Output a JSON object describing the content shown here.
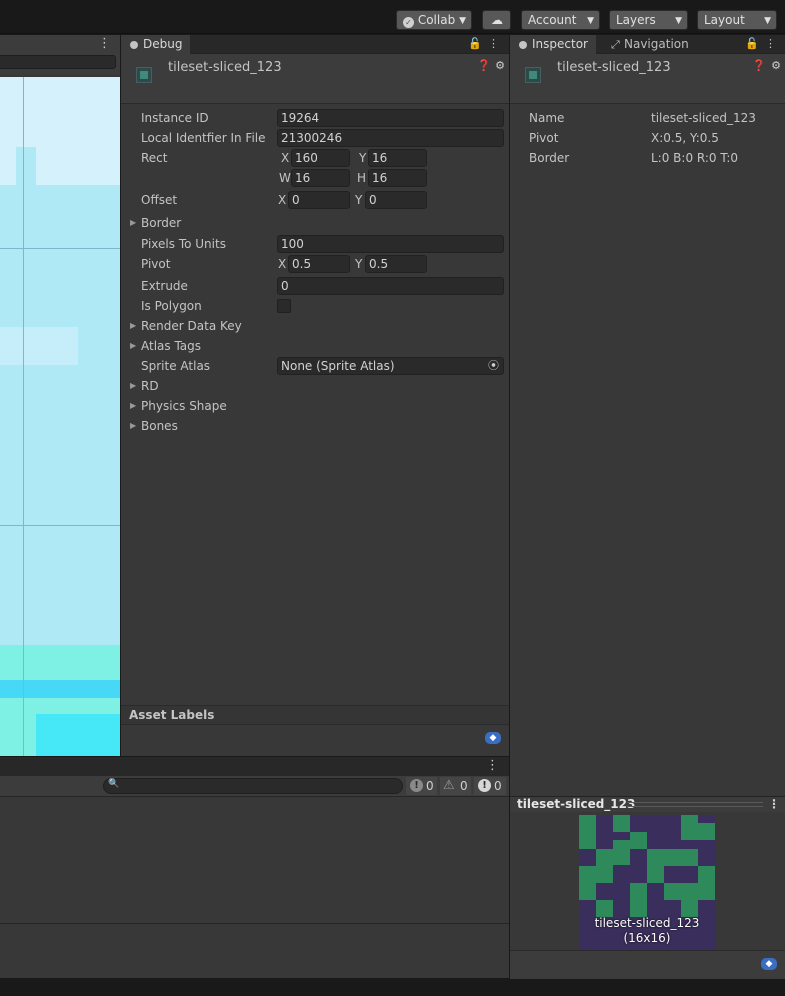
{
  "toolbar": {
    "collab": "Collab",
    "account": "Account",
    "layers": "Layers",
    "layout": "Layout"
  },
  "debug": {
    "tab_label": "Debug",
    "asset_name": "tileset-sliced_123",
    "fields": {
      "instance_id_label": "Instance ID",
      "instance_id": "19264",
      "local_id_label": "Local Identfier In File",
      "local_id": "21300246",
      "rect_label": "Rect",
      "rect_x": "160",
      "rect_y": "16",
      "rect_w": "16",
      "rect_h": "16",
      "offset_label": "Offset",
      "offset_x": "0",
      "offset_y": "0",
      "border_label": "Border",
      "ppu_label": "Pixels To Units",
      "ppu": "100",
      "pivot_label": "Pivot",
      "pivot_x": "0.5",
      "pivot_y": "0.5",
      "extrude_label": "Extrude",
      "extrude": "0",
      "is_polygon_label": "Is Polygon",
      "render_data_key_label": "Render Data Key",
      "atlas_tags_label": "Atlas Tags",
      "sprite_atlas_label": "Sprite Atlas",
      "sprite_atlas": "None (Sprite Atlas)",
      "rd_label": "RD",
      "physics_shape_label": "Physics Shape",
      "bones_label": "Bones"
    },
    "axis": {
      "x": "X",
      "y": "Y",
      "w": "W",
      "h": "H"
    },
    "asset_labels": "Asset Labels"
  },
  "inspector": {
    "tab_label": "Inspector",
    "nav_tab_label": "Navigation",
    "asset_name": "tileset-sliced_123",
    "rows": [
      {
        "label": "Name",
        "value": "tileset-sliced_123"
      },
      {
        "label": "Pivot",
        "value": "X:0.5, Y:0.5"
      },
      {
        "label": "Border",
        "value": "L:0 B:0 R:0 T:0"
      }
    ]
  },
  "console": {
    "log_count": "0",
    "warn_count": "0",
    "error_count": "0"
  },
  "preview": {
    "title": "tileset-sliced_123",
    "caption_name": "tileset-sliced_123",
    "caption_size": "(16x16)"
  }
}
